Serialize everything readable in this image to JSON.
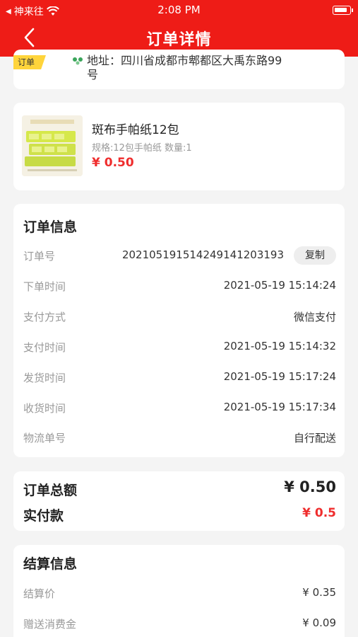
{
  "status_bar": {
    "carrier": "神来往",
    "time": "2:08 PM"
  },
  "nav": {
    "title": "订单详情"
  },
  "address": {
    "tag": "订单",
    "text": "地址：四川省成都市郫都区大禹东路99号"
  },
  "product": {
    "name": "斑布手帕纸12包",
    "spec": "规格:12包手帕纸  数量:1",
    "price": "¥ 0.50"
  },
  "order_info": {
    "title": "订单信息",
    "rows": [
      {
        "label": "订单号",
        "value": "20210519151424914120319​3"
      },
      {
        "label": "下单时间",
        "value": "2021-05-19 15:14:24"
      },
      {
        "label": "支付方式",
        "value": "微信支付"
      },
      {
        "label": "支付时间",
        "value": "2021-05-19 15:14:32"
      },
      {
        "label": "发货时间",
        "value": "2021-05-19 15:17:24"
      },
      {
        "label": "收货时间",
        "value": "2021-05-19 15:17:34"
      },
      {
        "label": "物流单号",
        "value": "自行配送"
      }
    ],
    "copy_label": "复制"
  },
  "totals": {
    "total_label": "订单总额",
    "total_value": "¥ 0.50",
    "paid_label": "实付款",
    "paid_value": "¥ 0.5"
  },
  "settlement": {
    "title": "结算信息",
    "rows": [
      {
        "label": "结算价",
        "value": "¥ 0.35"
      },
      {
        "label": "赠送消费金",
        "value": "¥ 0.09"
      }
    ]
  },
  "colors": {
    "header": "#ee1c17",
    "price": "#ef2d2d",
    "tag": "#ffd43b"
  }
}
